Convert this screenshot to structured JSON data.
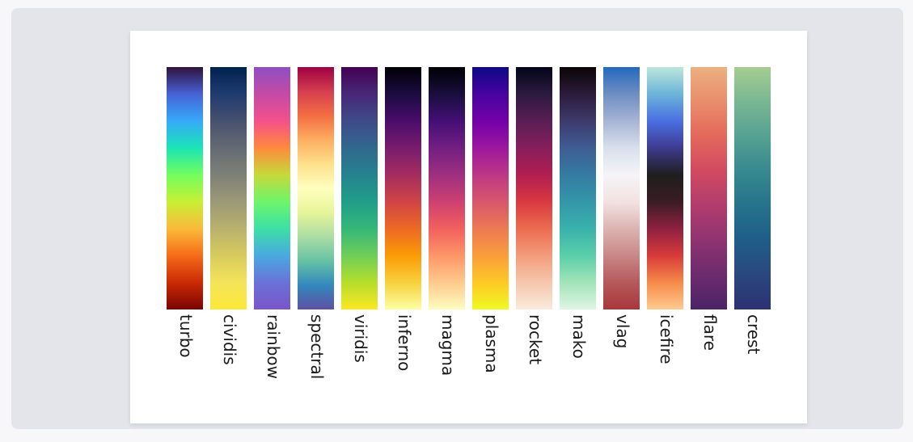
{
  "colormaps": [
    {
      "name": "turbo",
      "colors": [
        "#30123b",
        "#4662d7",
        "#36aaf9",
        "#1ae4b6",
        "#72fe5e",
        "#c8ef34",
        "#faba39",
        "#f66b19",
        "#ca2a04",
        "#7a0403"
      ]
    },
    {
      "name": "cividis",
      "colors": [
        "#00224e",
        "#1f3b70",
        "#47516f",
        "#646a73",
        "#7e8077",
        "#9b9977",
        "#b9b16d",
        "#d8cb5d",
        "#f4e45a",
        "#fee838"
      ]
    },
    {
      "name": "rainbow",
      "colors": [
        "#8f4fc4",
        "#c44aa6",
        "#f4508a",
        "#ff8a3c",
        "#c6d93a",
        "#6df56a",
        "#3de0a6",
        "#49a9e0",
        "#6a72d8",
        "#7a54c8"
      ]
    },
    {
      "name": "spectral",
      "colors": [
        "#9e0142",
        "#d53e4f",
        "#f46d43",
        "#fdae61",
        "#fee08b",
        "#ffffbf",
        "#e6f598",
        "#abdda4",
        "#66c2a5",
        "#3288bd",
        "#5e4fa2"
      ]
    },
    {
      "name": "viridis",
      "colors": [
        "#440154",
        "#482878",
        "#3e4a89",
        "#31688e",
        "#26828e",
        "#1f9e89",
        "#35b779",
        "#6ece58",
        "#b5de2b",
        "#fde725"
      ]
    },
    {
      "name": "inferno",
      "colors": [
        "#000004",
        "#1b0c41",
        "#4a0c6b",
        "#781c6d",
        "#a52c60",
        "#cf4446",
        "#ed6925",
        "#fb9b06",
        "#f7d13d",
        "#fcffa4"
      ]
    },
    {
      "name": "magma",
      "colors": [
        "#000004",
        "#180f3d",
        "#440f76",
        "#721f81",
        "#9e2f7f",
        "#cd4071",
        "#f1605d",
        "#fd9668",
        "#feca8d",
        "#fcfdbf"
      ]
    },
    {
      "name": "plasma",
      "colors": [
        "#0d0887",
        "#47039f",
        "#7301a8",
        "#9c179e",
        "#bd3786",
        "#d8576b",
        "#ed7953",
        "#fa9e3b",
        "#fdc926",
        "#f0f921"
      ]
    },
    {
      "name": "rocket",
      "colors": [
        "#03051a",
        "#2b1a3e",
        "#5a1e55",
        "#861e5b",
        "#b21e52",
        "#d9393f",
        "#ec6c4f",
        "#f39c7a",
        "#f6c6ad",
        "#faebdd"
      ]
    },
    {
      "name": "mako",
      "colors": [
        "#0b0405",
        "#2b1b3a",
        "#3d3a6d",
        "#3e5d93",
        "#357ba2",
        "#3496a9",
        "#39b2ac",
        "#5acfa8",
        "#a3e4b9",
        "#def5e5"
      ]
    },
    {
      "name": "vlag",
      "colors": [
        "#2369bd",
        "#6e8ec3",
        "#a6b4d6",
        "#d8dfec",
        "#f5f4f7",
        "#f3e2e1",
        "#dcb4b1",
        "#c98786",
        "#b5595c",
        "#a9373b"
      ]
    },
    {
      "name": "icefire",
      "colors": [
        "#bde7db",
        "#6bb4d8",
        "#4a6fe3",
        "#3e3b90",
        "#1f1e1e",
        "#3a1c24",
        "#8e2140",
        "#d83a3a",
        "#f68a4a",
        "#ffcb8f"
      ]
    },
    {
      "name": "flare",
      "colors": [
        "#edb081",
        "#e98d6b",
        "#e3685c",
        "#d14a61",
        "#b13c6c",
        "#8f3371",
        "#6c2b6d",
        "#4b2465"
      ]
    },
    {
      "name": "crest",
      "colors": [
        "#a5cd90",
        "#79b793",
        "#55a192",
        "#36898f",
        "#25738c",
        "#1f5d88",
        "#2a477f",
        "#2c3172"
      ]
    }
  ]
}
